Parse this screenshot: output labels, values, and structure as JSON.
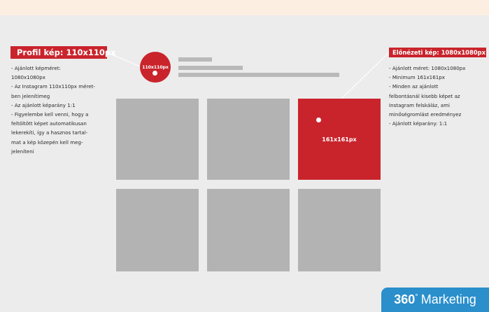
{
  "profile": {
    "label": "Profil kép: 110x110px",
    "circle_text": "110x110px",
    "notes": [
      "- Ajánlott képméret:",
      "1080x1080px",
      "- Az Instagram 110x110px méret-",
      "ben jelenítimeg",
      "- Az ajánlott képarány 1:1",
      "- Figyelembe kell venni, hogy a",
      "feltöltött képet automatikusan",
      "lekerekíti, így a hasznos tartal-",
      "mat a kép közepén kell meg-",
      "jeleníteni"
    ]
  },
  "preview": {
    "label": "Előnézeti kép: 1080x1080px",
    "tile_text": "161x161px",
    "notes": [
      "- Ajánlott méret: 1080x1080px",
      "- Minimum 161x161px",
      "- Minden az ajánlott",
      "felbontásnál kisebb képet az",
      "Instagram felskáláz, ami",
      "minőségromlást eredményez",
      "- Ajánlott képarány: 1:1"
    ]
  },
  "brand": {
    "number": "360",
    "degree": "°",
    "name": "Marketing"
  },
  "colors": {
    "accent_red": "#c9242c",
    "brand_blue": "#2a8fcb",
    "tile_gray": "#b3b3b3",
    "panel_gray": "#ececec"
  }
}
